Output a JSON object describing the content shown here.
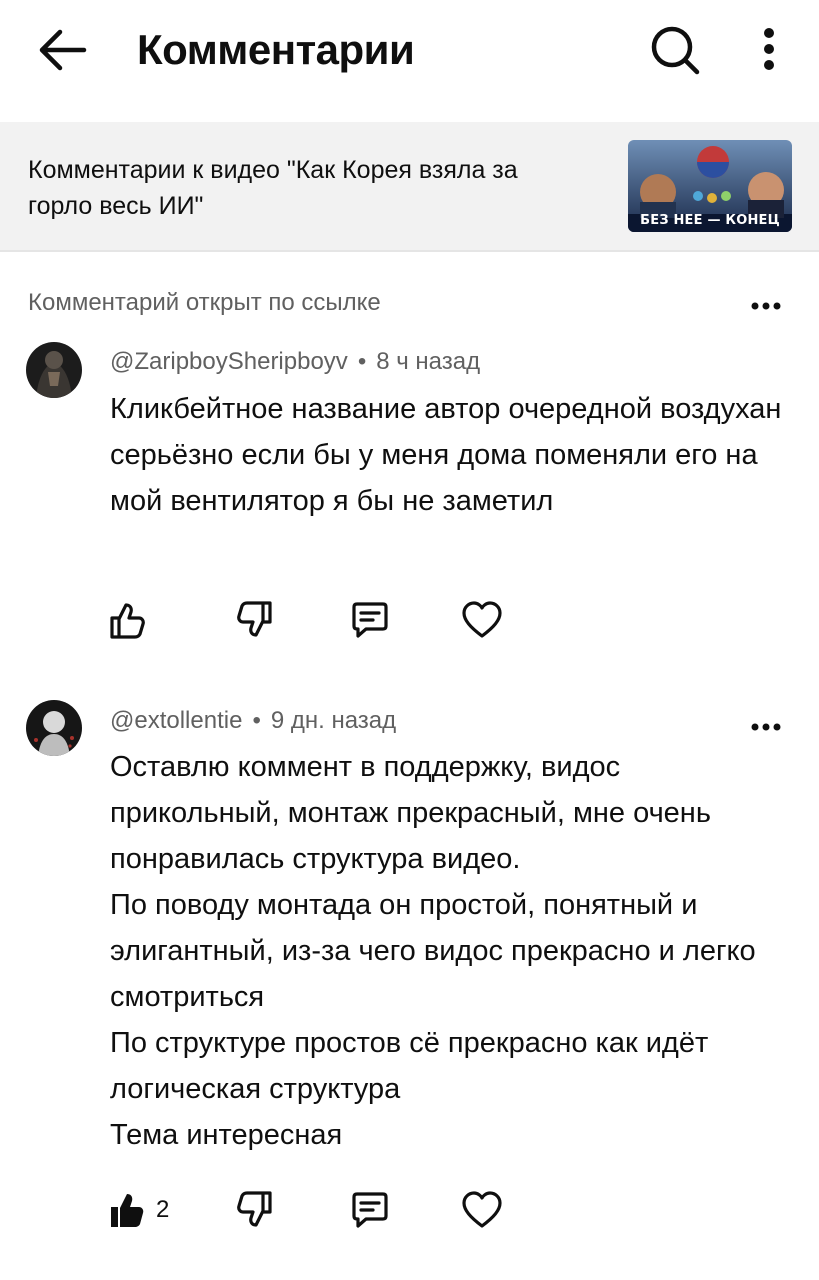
{
  "header": {
    "title": "Комментарии",
    "back_icon": "arrow-left-icon",
    "search_icon": "search-icon",
    "more_icon": "more-vertical-icon"
  },
  "context": {
    "text": "Комментарии к видео \"Как Корея взяла за горло весь ИИ\"",
    "thumbnail_caption": "БЕЗ НЕЕ — КОНЕЦ"
  },
  "section_label": "Комментарий открыт по ссылке",
  "comments": [
    {
      "author": "@ZaripboySheripboyv",
      "time": "8 ч назад",
      "text": "Кликбейтное название автор очередной воздухан серьёзно если бы у меня дома поменяли его на мой вентилятор я бы не заметил",
      "likes": ""
    },
    {
      "author": "@extollentie",
      "time": "9 дн. назад",
      "text_lines": [
        "Оставлю коммент в поддержку, видос прикольный, монтаж прекрасный, мне очень понравилась структура видео.",
        "По поводу монтада он простой, понятный и элигантный, из-за чего видос прекрасно и легко смотриться",
        "По структуре простов сё прекрасно как идёт логическая структура",
        "Тема интересная"
      ],
      "likes": "2"
    }
  ],
  "colors": {
    "text": "#0f0f0f",
    "secondary": "#606060",
    "banner_bg": "#f2f2f2"
  }
}
